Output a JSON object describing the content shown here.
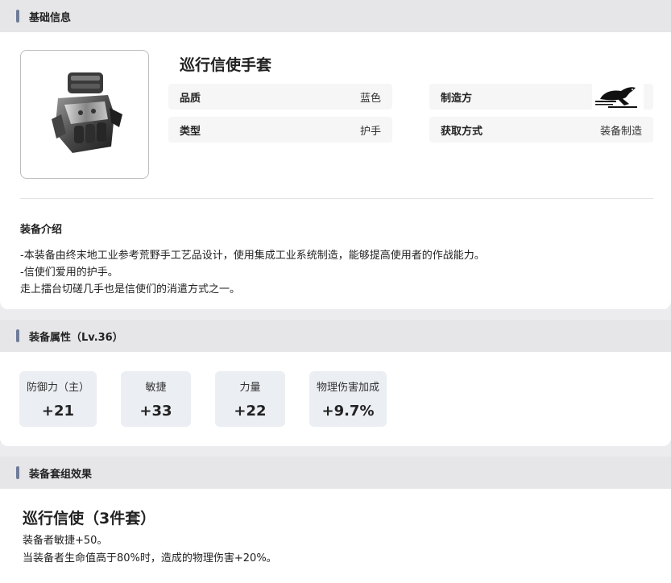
{
  "sections": {
    "basic": "基础信息",
    "attributes": "装备属性（Lv.36）",
    "set": "装备套组效果"
  },
  "item": {
    "name": "巡行信使手套",
    "icon": "glove-icon",
    "fields": [
      {
        "key": "品质",
        "value": "蓝色"
      },
      {
        "key": "制造方",
        "value_icon": "crow-logo-icon"
      },
      {
        "key": "类型",
        "value": "护手"
      },
      {
        "key": "获取方式",
        "value": "装备制造"
      }
    ]
  },
  "description": {
    "title": "装备介绍",
    "lines": [
      "-本装备由终末地工业参考荒野手工艺品设计，使用集成工业系统制造，能够提高使用者的作战能力。",
      "-信使们爱用的护手。",
      "走上擂台切磋几手也是信使们的消遣方式之一。"
    ]
  },
  "stats": [
    {
      "label": "防御力（主）",
      "value": "+21"
    },
    {
      "label": "敏捷",
      "value": "+33"
    },
    {
      "label": "力量",
      "value": "+22"
    },
    {
      "label": "物理伤害加成",
      "value": "+9.7%"
    }
  ],
  "set_effect": {
    "name": "巡行信使（3件套）",
    "lines": [
      "装备者敏捷+50。",
      "当装备者生命值高于80%时，造成的物理伤害+20%。"
    ]
  },
  "colors": {
    "accent_bar": "#6f7c99",
    "stat_bg": "#ebeef2",
    "header_bg": "#e6e6e8"
  }
}
